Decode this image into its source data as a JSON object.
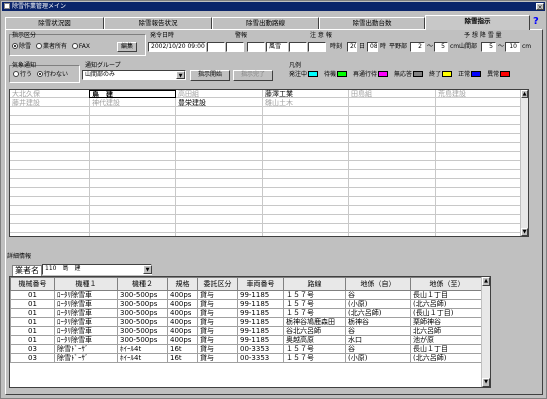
{
  "window": {
    "title": "除雪作業管理メイン",
    "close": "×"
  },
  "tabs": [
    {
      "label": "除雪状況図"
    },
    {
      "label": "除雪報告状況"
    },
    {
      "label": "除雪出動路線"
    },
    {
      "label": "除雪出動台数"
    },
    {
      "label": "除雪指示"
    }
  ],
  "help": "?",
  "form": {
    "notify_label": "指示区分",
    "notify_opts": [
      "除雪",
      "業者所有",
      "FAX"
    ],
    "edit_btn": "編集",
    "dispatch_label": "発令日時",
    "dispatch_value": "2002/10/20 09:00",
    "warning_label": "警報",
    "caution_label": "注 意 報",
    "caution_value": "風雪",
    "forecast_label": "予 想 降 雪 量",
    "time_label": "時刻",
    "day": "20",
    "day_unit": "日",
    "hour": "08",
    "hour_unit": "時",
    "plain_label": "平野部",
    "plain_from": "2",
    "plain_to": "5",
    "plain_unit": "cm",
    "mount_label": "山間部",
    "mount_from": "5",
    "mount_to": "10",
    "mount_unit": "cm",
    "tilde": "～",
    "weather_label": "気象通知",
    "weather_opts": [
      "行う",
      "行わない"
    ],
    "group_label": "通知グループ",
    "group_value": "山間部のみ",
    "start_btn": "指示開始",
    "cancel_btn": "指示完了",
    "legend_label": "凡例",
    "legend": [
      {
        "name": "発注中",
        "color": "#00ffff"
      },
      {
        "name": "待機",
        "color": "#00ff00"
      },
      {
        "name": "再通行待",
        "color": "#ff00ff"
      },
      {
        "name": "無応答",
        "color": "#808080"
      },
      {
        "name": "終了",
        "color": "#ffff00"
      },
      {
        "name": "正常",
        "color": "#0000ff"
      },
      {
        "name": "異常",
        "color": "#ff0000"
      }
    ]
  },
  "grid": {
    "rows": [
      [
        "大北久保",
        "島　建",
        "高田組",
        "藤澤工業",
        "田島組",
        "荒島建設"
      ],
      [
        "藤井建設",
        "神代建設",
        "豊栄建設",
        "雛山土木",
        "",
        ""
      ]
    ]
  },
  "detail": {
    "section_label": "詳細情報",
    "vendor_label": "業者名",
    "vendor_value": "110　島　建",
    "columns": [
      "機械番号",
      "機種１",
      "機種２",
      "規格",
      "委託区分",
      "車両番号",
      "路線",
      "地係（自）",
      "地係（至）"
    ],
    "rows": [
      [
        "01",
        "ﾛｰﾀﾘ除雪車",
        "300-500ps",
        "400ps",
        "貸与",
        "99-1185",
        "１５７号",
        "谷",
        "長山１丁目"
      ],
      [
        "01",
        "ﾛｰﾀﾘ除雪車",
        "300-500ps",
        "400ps",
        "貸与",
        "99-1185",
        "１５７号",
        "(小原)",
        "(北六呂師)"
      ],
      [
        "01",
        "ﾛｰﾀﾘ除雪車",
        "300-500ps",
        "400ps",
        "貸与",
        "99-1185",
        "１５７号",
        "(北六呂師)",
        "(長山１丁目)"
      ],
      [
        "01",
        "ﾛｰﾀﾘ除雪車",
        "300-500ps",
        "400ps",
        "貸与",
        "99-1185",
        "栃神谷鳩鹿森田",
        "栃神谷",
        "栗師神谷"
      ],
      [
        "01",
        "ﾛｰﾀﾘ除雪車",
        "300-500ps",
        "400ps",
        "貸与",
        "99-1185",
        "谷北六呂師",
        "谷",
        "北六呂師"
      ],
      [
        "01",
        "ﾛｰﾀﾘ除雪車",
        "300-500ps",
        "400ps",
        "貸与",
        "99-1185",
        "奥越高原",
        "水口",
        "池が原"
      ],
      [
        "03",
        "除雪ﾄﾞｰｻﾞ",
        "ﾎｲｰﾙ4t",
        "16t",
        "貸与",
        "00-3353",
        "１５７号",
        "谷",
        "長山１丁目"
      ],
      [
        "03",
        "除雪ﾄﾞｰｻﾞ",
        "ﾎｲｰﾙ4t",
        "16t",
        "貸与",
        "00-3353",
        "１５７号",
        "(小原)",
        "(北六呂師)"
      ]
    ]
  }
}
